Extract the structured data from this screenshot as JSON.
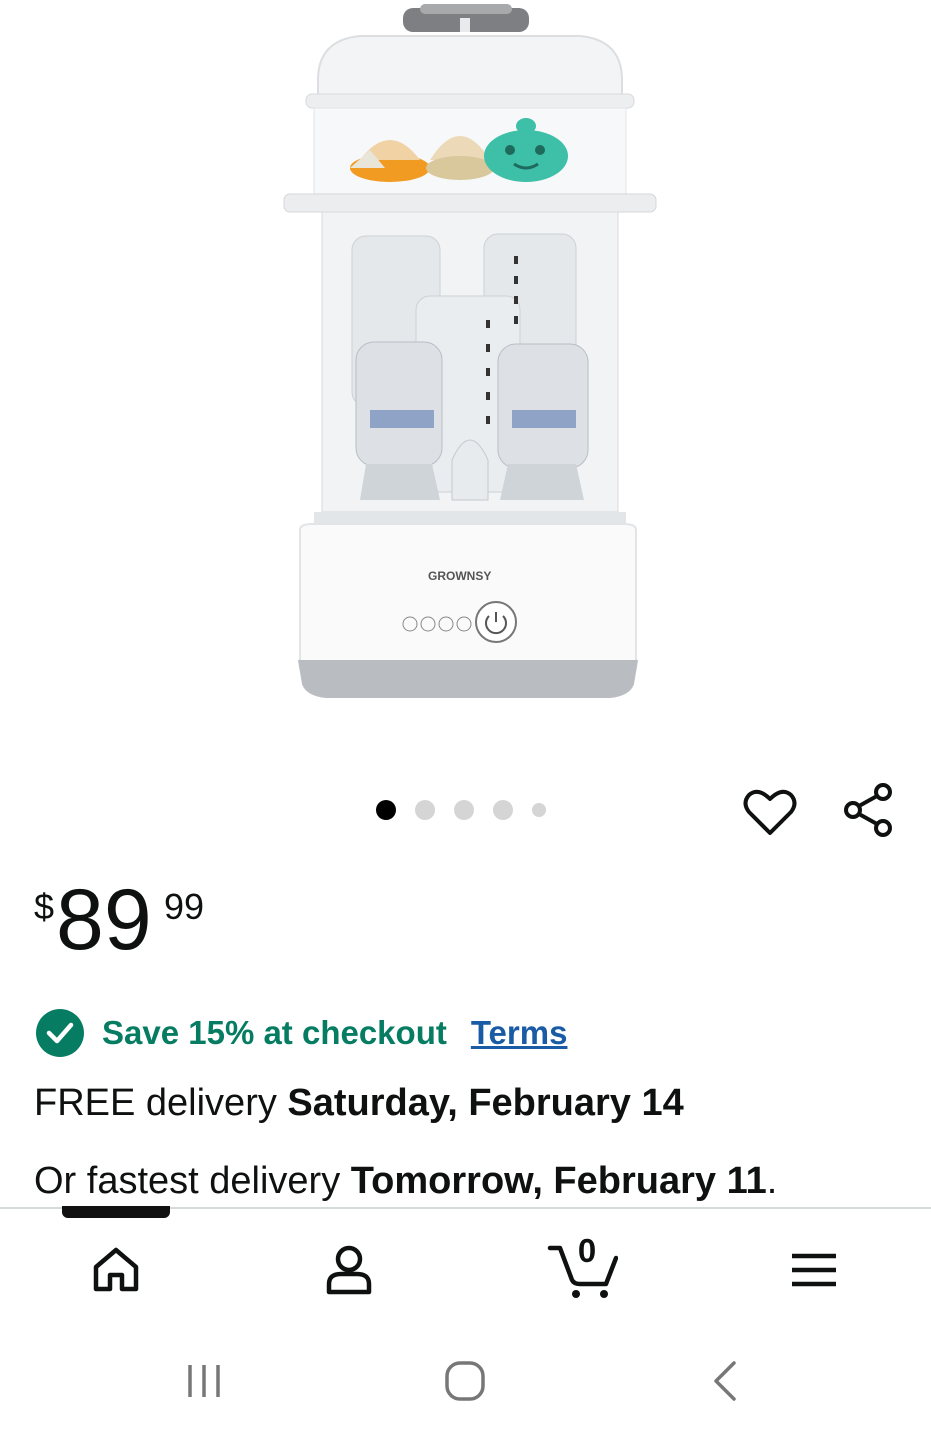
{
  "product": {
    "brand_mark": "GROWNSY"
  },
  "carousel": {
    "total": 5,
    "active_index": 0
  },
  "price": {
    "currency": "$",
    "whole": "89",
    "fraction": "99"
  },
  "promo": {
    "text": "Save 15% at checkout",
    "terms_label": "Terms"
  },
  "delivery": {
    "free_prefix": "FREE delivery",
    "free_date": "Saturday, February 14",
    "fast_prefix": "Or fastest delivery",
    "fast_date": "Tomorrow, February 11",
    "fast_suffix": "."
  },
  "tabbar": {
    "cart_count": "0"
  },
  "colors": {
    "promo_green": "#067d62",
    "link_blue": "#1a5ba6",
    "text": "#0f1111"
  },
  "icons": [
    "heart-icon",
    "share-icon",
    "home-icon",
    "account-icon",
    "cart-icon",
    "menu-icon",
    "recent-apps-icon",
    "home-circle-icon",
    "back-icon"
  ]
}
